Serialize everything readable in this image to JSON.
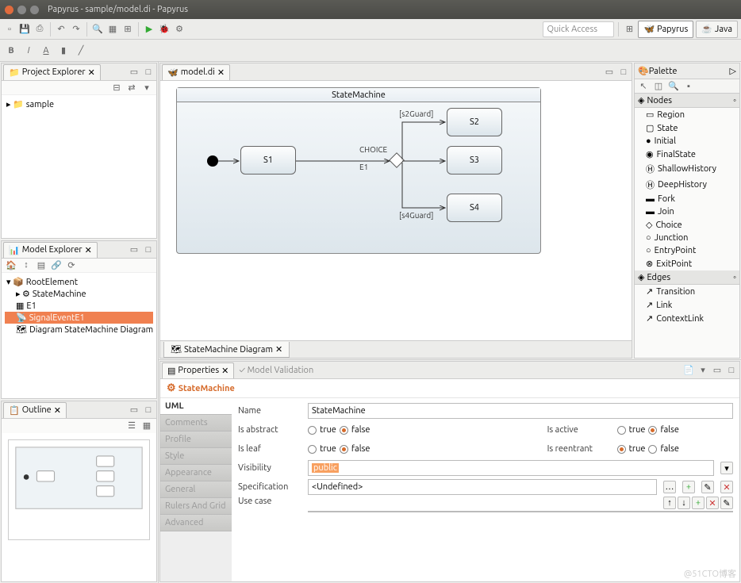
{
  "window": {
    "title": "Papyrus - sample/model.di - Papyrus"
  },
  "quick_access": "Quick Access",
  "perspectives": [
    {
      "label": "Papyrus",
      "active": true
    },
    {
      "label": "Java",
      "active": false
    }
  ],
  "project_explorer": {
    "title": "Project Explorer",
    "items": [
      {
        "label": "sample"
      }
    ]
  },
  "model_explorer": {
    "title": "Model Explorer",
    "items": [
      {
        "label": "RootElement",
        "indent": 0
      },
      {
        "label": "StateMachine",
        "indent": 1
      },
      {
        "label": "E1",
        "indent": 1
      },
      {
        "label": "SignalEventE1",
        "indent": 1,
        "selected": true
      },
      {
        "label": "Diagram StateMachine Diagram",
        "indent": 1
      }
    ]
  },
  "outline": {
    "title": "Outline"
  },
  "editor": {
    "tab": "model.di",
    "diagram_tab": "StateMachine Diagram",
    "state_machine_title": "StateMachine",
    "states": {
      "S1": "S1",
      "S2": "S2",
      "S3": "S3",
      "S4": "S4"
    },
    "labels": {
      "choice": "CHOICE",
      "e1": "E1",
      "s2guard": "[s2Guard]",
      "s4guard": "[s4Guard]"
    }
  },
  "palette": {
    "title": "Palette",
    "sections": {
      "nodes": "Nodes",
      "edges": "Edges"
    },
    "nodes": [
      "Region",
      "State",
      "Initial",
      "FinalState",
      "ShallowHistory",
      "DeepHistory",
      "Fork",
      "Join",
      "Choice",
      "Junction",
      "EntryPoint",
      "ExitPoint"
    ],
    "edges": [
      "Transition",
      "Link",
      "ContextLink"
    ]
  },
  "properties": {
    "tab1": "Properties",
    "tab2": "Model Validation",
    "element": "StateMachine",
    "categories": [
      "UML",
      "Comments",
      "Profile",
      "Style",
      "Appearance",
      "General",
      "Rulers And Grid",
      "Advanced"
    ],
    "active_category": "UML",
    "fields": {
      "name_label": "Name",
      "name_value": "StateMachine",
      "is_abstract_label": "Is abstract",
      "is_abstract": "false",
      "is_leaf_label": "Is leaf",
      "is_leaf": "false",
      "is_active_label": "Is active",
      "is_active": "false",
      "is_reentrant_label": "Is reentrant",
      "is_reentrant": "true",
      "visibility_label": "Visibility",
      "visibility": "public",
      "specification_label": "Specification",
      "specification": "<Undefined>",
      "use_case_label": "Use case",
      "true": "true",
      "false": "false"
    }
  },
  "watermark": "@51CTO博客"
}
